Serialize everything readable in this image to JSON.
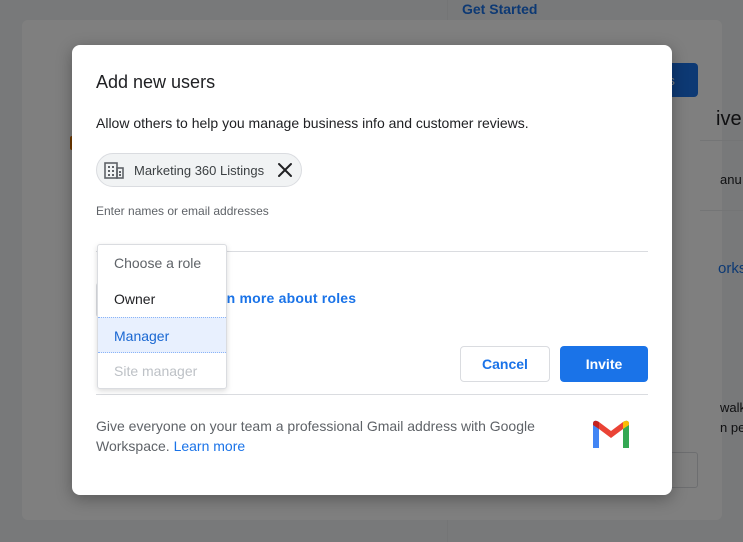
{
  "background": {
    "get_started_label": "Get Started",
    "blue_button_label": "rs",
    "partial_texts": [
      "ive",
      "anu",
      "orks",
      "walk",
      "n pe"
    ]
  },
  "dialog": {
    "title": "Add new users",
    "description": "Allow others to help you manage business info and customer reviews.",
    "chip": {
      "icon": "building-icon",
      "label": "Marketing 360 Listings",
      "close_icon": "close-icon"
    },
    "input_placeholder": "Enter names or email addresses",
    "learn_roles_text": "arn more about roles",
    "cancel_label": "Cancel",
    "invite_label": "Invite",
    "promo_text": "Give everyone on your team a professional Gmail address with Google Workspace.",
    "promo_link": "Learn more",
    "promo_icon": "gmail-icon"
  },
  "role_menu": {
    "items": [
      {
        "label": "Choose a role",
        "state": "header"
      },
      {
        "label": "Owner",
        "state": "normal"
      },
      {
        "label": "Manager",
        "state": "selected"
      },
      {
        "label": "Site manager",
        "state": "disabled"
      }
    ]
  },
  "colors": {
    "accent": "#1a73e8",
    "selected_bg": "#e8f0fe",
    "scrim": "rgba(0,0,0,0.5)"
  }
}
